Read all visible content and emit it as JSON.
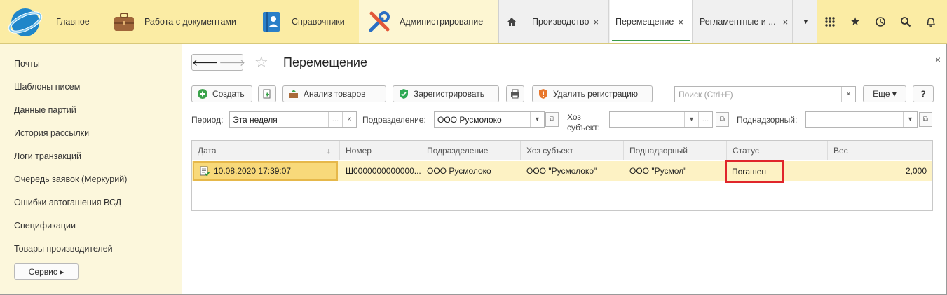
{
  "sections": [
    {
      "label": "Главное",
      "icon": "menu-lines-icon"
    },
    {
      "label": "Работа с документами",
      "icon": "briefcase-icon"
    },
    {
      "label": "Справочники",
      "icon": "address-book-icon"
    },
    {
      "label": "Администрирование",
      "icon": "tools-icon"
    }
  ],
  "tabs": [
    {
      "label": "Производство"
    },
    {
      "label": "Перемещение"
    },
    {
      "label": "Регламентные и ..."
    }
  ],
  "sidebar": {
    "items": [
      "Почты",
      "Шаблоны писем",
      "Данные партий",
      "История рассылки",
      "Логи транзакций",
      "Очередь заявок (Меркурий)",
      "Ошибки автогашения ВСД",
      "Спецификации",
      "Товары производителей"
    ],
    "service_button": "Сервис ▸"
  },
  "form": {
    "title": "Перемещение",
    "toolbar": {
      "create": "Создать",
      "analysis": "Анализ товаров",
      "register": "Зарегистрировать",
      "delete_reg": "Удалить регистрацию",
      "search_placeholder": "Поиск (Ctrl+F)",
      "more": "Еще ▾",
      "help": "?"
    },
    "filters": {
      "period_label": "Период:",
      "period_value": "Эта неделя",
      "division_label": "Подразделение:",
      "division_value": "ООО Русмолоко",
      "entity_label_1": "Хоз",
      "entity_label_2": "субъект:",
      "entity_value": "",
      "supervised_label": "Поднадзорный:",
      "supervised_value": ""
    }
  },
  "table": {
    "columns": [
      "Дата",
      "Номер",
      "Подразделение",
      "Хоз субъект",
      "Поднадзорный",
      "Статус",
      "Вес"
    ],
    "rows": [
      {
        "date": "10.08.2020 17:39:07",
        "number": "Ш0000000000000...",
        "division": "ООО Русмолоко",
        "entity": "ООО \"Русмолоко\"",
        "supervised": "ООО \"Русмол\"",
        "status": "Погашен",
        "weight": "2,000"
      }
    ]
  },
  "colors": {
    "topbar": "#fbeca4",
    "sidebar": "#fcf7dc",
    "row_selected": "#fdf2c4",
    "highlight": "#e0262b",
    "accent_green": "#3a9a4a"
  }
}
